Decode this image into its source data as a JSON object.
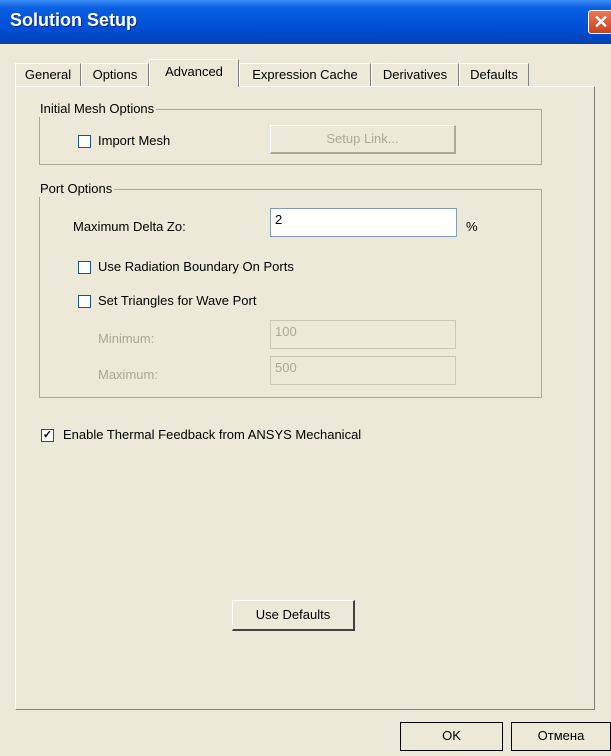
{
  "window": {
    "title": "Solution Setup",
    "close_glyph": "✕"
  },
  "tabs": [
    {
      "label": "General"
    },
    {
      "label": "Options"
    },
    {
      "label": "Advanced"
    },
    {
      "label": "Expression Cache"
    },
    {
      "label": "Derivatives"
    },
    {
      "label": "Defaults"
    }
  ],
  "initial_mesh": {
    "legend": "Initial Mesh Options",
    "import_mesh_label": "Import Mesh",
    "import_mesh_checked": false,
    "setup_link_label": "Setup Link..."
  },
  "port_options": {
    "legend": "Port Options",
    "max_delta_zo_label": "Maximum Delta Zo:",
    "max_delta_zo_value": "2",
    "percent_unit": "%",
    "radiation_label": "Use Radiation Boundary On Ports",
    "radiation_checked": false,
    "triangles_label": "Set Triangles for Wave Port",
    "triangles_checked": false,
    "minimum_label": "Minimum:",
    "minimum_value": "100",
    "maximum_label": "Maximum:",
    "maximum_value": "500"
  },
  "thermal": {
    "label": "Enable Thermal Feedback from ANSYS Mechanical",
    "checked_mark": "✓"
  },
  "use_defaults_label": "Use Defaults",
  "footer": {
    "ok_label": "OK",
    "cancel_label": "Отмена"
  }
}
